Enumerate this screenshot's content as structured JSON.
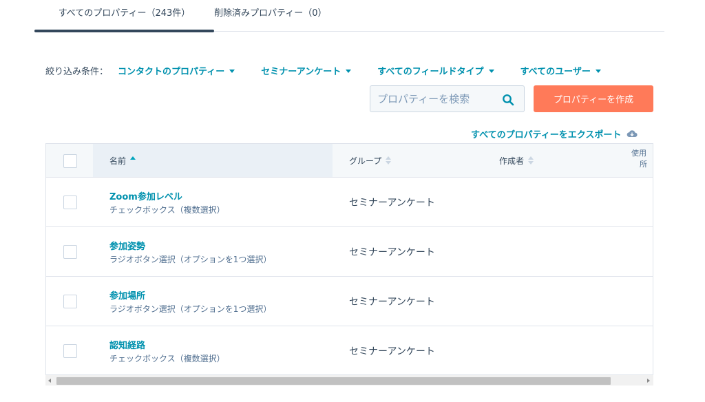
{
  "tabs": [
    {
      "label": "すべてのプロパティー（243件）",
      "active": true
    },
    {
      "label": "削除済みプロパティー（0）",
      "active": false
    }
  ],
  "filters": {
    "label": "絞り込み条件：",
    "items": [
      {
        "label": "コンタクトのプロパティー"
      },
      {
        "label": "セミナーアンケート"
      },
      {
        "label": "すべてのフィールドタイプ"
      },
      {
        "label": "すべてのユーザー"
      }
    ]
  },
  "search": {
    "placeholder": "プロパティーを検索",
    "value": ""
  },
  "create_button": {
    "label": "プロパティーを作成"
  },
  "export_link": {
    "label": "すべてのプロパティーをエクスポート"
  },
  "table": {
    "columns": {
      "name": "名前",
      "group": "グループ",
      "creator": "作成者",
      "usage_line1": "使用",
      "usage_line2": "所"
    },
    "rows": [
      {
        "name": "Zoom参加レベル",
        "type": "チェックボックス（複数選択）",
        "group": "セミナーアンケート"
      },
      {
        "name": "参加姿勢",
        "type": "ラジオボタン選択（オプションを1つ選択）",
        "group": "セミナーアンケート"
      },
      {
        "name": "参加場所",
        "type": "ラジオボタン選択（オプションを1つ選択）",
        "group": "セミナーアンケート"
      },
      {
        "name": "認知経路",
        "type": "チェックボックス（複数選択）",
        "group": "セミナーアンケート"
      }
    ]
  },
  "colors": {
    "link": "#0091ae",
    "primary_button": "#ff7a59",
    "text": "#33475b",
    "header_bg": "#f5f8fa"
  }
}
